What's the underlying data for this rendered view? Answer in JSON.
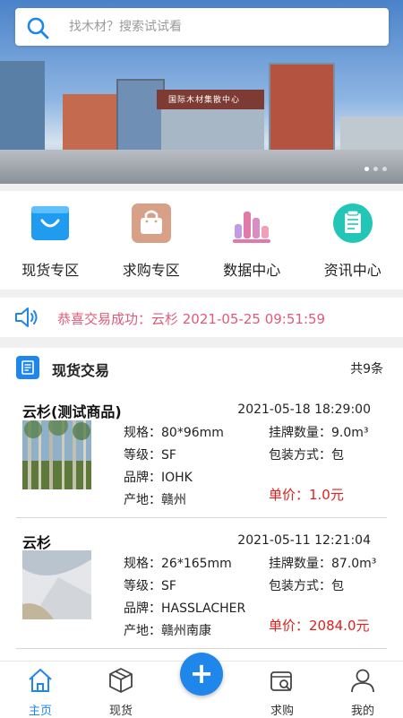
{
  "search": {
    "placeholder": "找木材？搜索试试看"
  },
  "banner": {
    "sign_text": "国际木材集散中心"
  },
  "quick_menu": [
    {
      "label": "现货专区",
      "icon": "shopping-bag-icon"
    },
    {
      "label": "求购专区",
      "icon": "handbag-icon"
    },
    {
      "label": "数据中心",
      "icon": "bar-chart-icon"
    },
    {
      "label": "资讯中心",
      "icon": "news-document-icon"
    }
  ],
  "notice": {
    "text": "恭喜交易成功：云杉   2021-05-25 09:51:59",
    "icon": "speaker-icon",
    "color": "#e05a7a"
  },
  "section": {
    "title": "现货交易",
    "count": "共9条",
    "icon": "list-document-icon"
  },
  "listings": [
    {
      "name": "云杉(测试商品)",
      "time": "2021-05-18 18:29:00",
      "spec": "规格：80*96mm",
      "quantity": "挂牌数量：9.0m³",
      "grade": "等级：SF",
      "packing": "包装方式：包",
      "brand": "品牌：IOHK",
      "origin": "产地：赣州",
      "price": "单价：1.0元"
    },
    {
      "name": "云杉",
      "time": "2021-05-11 12:21:04",
      "spec": "规格：26*165mm",
      "quantity": "挂牌数量：87.0m³",
      "grade": "等级：SF",
      "packing": "包装方式：包",
      "brand": "品牌：HASSLACHER",
      "origin": "产地：赣州南康",
      "price": "单价：2084.0元"
    }
  ],
  "tabbar": {
    "home": "主页",
    "spot": "现货",
    "purchase": "求购",
    "mine": "我的",
    "fab": "+"
  },
  "colors": {
    "accent": "#1f86ea",
    "price": "#e0201a"
  }
}
